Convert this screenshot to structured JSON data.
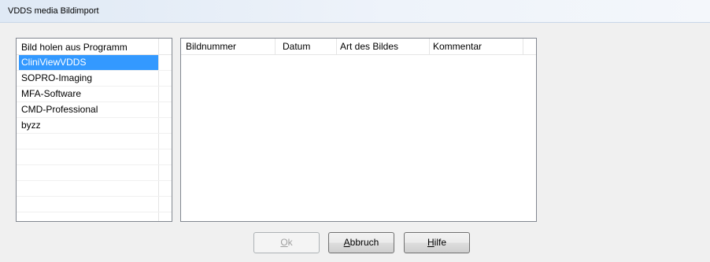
{
  "window": {
    "title": "VDDS media Bildimport"
  },
  "program_list": {
    "header": "Bild holen aus Programm",
    "items": [
      {
        "label": "CliniViewVDDS",
        "selected": true
      },
      {
        "label": "SOPRO-Imaging",
        "selected": false
      },
      {
        "label": "MFA-Software",
        "selected": false
      },
      {
        "label": "CMD-Professional",
        "selected": false
      },
      {
        "label": "byzz",
        "selected": false
      }
    ]
  },
  "image_table": {
    "columns": [
      "Bildnummer",
      "Datum",
      "Art des Bildes",
      "Kommentar"
    ],
    "rows": []
  },
  "buttons": {
    "ok": {
      "mnemonic": "O",
      "rest": "k",
      "enabled": false
    },
    "cancel": {
      "mnemonic": "A",
      "rest": "bbruch",
      "enabled": true
    },
    "help": {
      "mnemonic": "H",
      "rest": "ilfe",
      "enabled": true
    }
  },
  "colors": {
    "selection": "#3399ff",
    "window_bg": "#f0f0f0",
    "list_border": "#828790"
  }
}
